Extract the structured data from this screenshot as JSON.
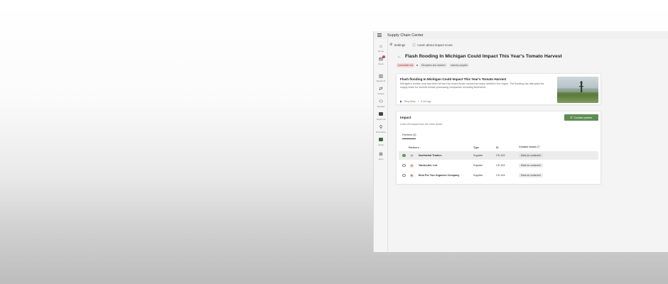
{
  "app": {
    "title": "Supply Chain Center"
  },
  "toolbar": {
    "settings": "Settings",
    "learn": "Learn about impact score"
  },
  "rail": [
    {
      "name": "home",
      "label": "Home",
      "glyph": "⌂"
    },
    {
      "name": "news",
      "label": "News",
      "glyph": "▤",
      "badge": "1"
    },
    {
      "name": "supply-ai",
      "label": "Supply AI",
      "glyph": "▥"
    },
    {
      "name": "orders",
      "label": "Orders",
      "glyph": "⇄"
    },
    {
      "name": "supplier",
      "label": "Supplier",
      "glyph": "⚇"
    },
    {
      "name": "shipment",
      "label": "Shipment",
      "glyph": "▣"
    },
    {
      "name": "recruitment",
      "label": "Recruitme",
      "glyph": "⚲"
    },
    {
      "name": "news2",
      "label": "News",
      "glyph": "▣"
    },
    {
      "name": "apps",
      "label": "Apps",
      "glyph": "⊞"
    }
  ],
  "page": {
    "back_glyph": "←",
    "title": "Flash flooding In Michigan Could Impact This Year's Tomato Harvest",
    "tags": [
      "Immediate risk",
      "Disruption and weather",
      "Industry supplier"
    ]
  },
  "news": {
    "title": "Flash flooding In Michigan Could Impact This Year's Tomato Harvest",
    "body": "Michigan's tomato crop has been hit hard by recent floods caused by heavy rainfall in the region. The flooding has disrupted the supply chain for several tomato processing companies, including Northwind...",
    "source": "Bing News",
    "time": "5 min ago"
  },
  "impact": {
    "title": "Impact",
    "subtitle": "Learn the impact from the news article",
    "contact_button": "Contact partner",
    "tab": "Partners (3)",
    "columns": {
      "partners": "Partners ↑",
      "type": "Type",
      "id": "ID",
      "status": "Contact status ⓘ"
    },
    "rows": [
      {
        "initials": "NT",
        "partner": "Northwind Traders",
        "type": "Supplier",
        "id": "CS-102",
        "status": "Mark as contacted",
        "selected": true
      },
      {
        "initials": "VA",
        "partner": "VanArsdel, Ltd.",
        "type": "Supplier",
        "id": "CS-103",
        "status": "Mark as contacted",
        "selected": false
      },
      {
        "initials": "BF",
        "partner": "Best For You Organics Company",
        "type": "Supplier",
        "id": "CS-104",
        "status": "Mark as contacted",
        "selected": false
      }
    ]
  }
}
